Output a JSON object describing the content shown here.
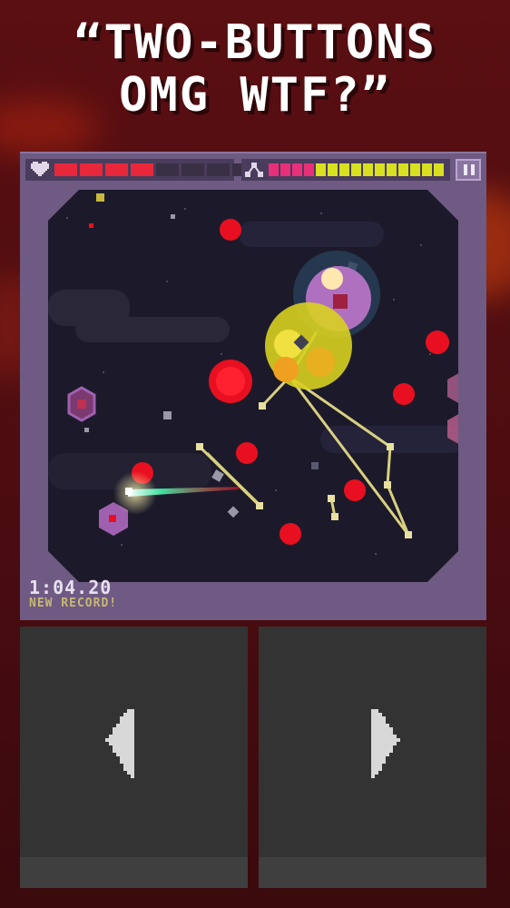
{
  "banner": {
    "line1": "“TWO-BUTTONS",
    "line2": "OMG WTF?”"
  },
  "hud": {
    "health_icon": "heart-icon",
    "health_segments_total": 8,
    "health_segments_filled": 4,
    "dash_icon": "dash-link-icon",
    "energy_segments_total": 15,
    "energy_segments_pink": 4,
    "energy_segments_yellow": 11,
    "pause_icon": "pause-icon"
  },
  "stats": {
    "timer": "1:04.20",
    "record_label": "NEW RECORD!"
  },
  "controls": {
    "left_icon": "arrow-left-icon",
    "right_icon": "arrow-right-icon"
  },
  "colors": {
    "background": "#4a0c10",
    "device": "#6e5a82",
    "arena": "#1c1a2a",
    "health_on": "#e8283a",
    "energy_pink": "#e8307a",
    "energy_yellow": "#d8e020",
    "enemy_red": "#e81020",
    "enemy_purple": "#a060b0",
    "tether": "#d8d080",
    "control_panel": "#333333"
  }
}
